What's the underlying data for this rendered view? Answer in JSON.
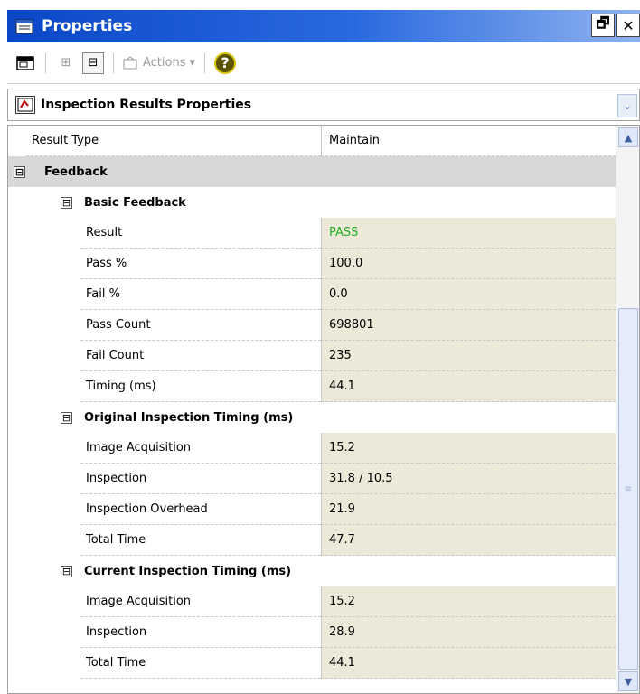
{
  "window": {
    "title": "Properties",
    "restore_glyph": "🗗",
    "close_glyph": "✕"
  },
  "toolbar": {
    "expand_glyph": "⊞",
    "collapse_glyph": "⊟",
    "actions_label": "Actions",
    "actions_arrow": "▾",
    "help_glyph": "?"
  },
  "selector": {
    "label": "Inspection Results Properties",
    "arrow": "⌄"
  },
  "grid": {
    "top_row": {
      "name": "Result Type",
      "value": "Maintain"
    },
    "category": {
      "label": "Feedback",
      "toggle": "⊟"
    },
    "groups": [
      {
        "label": "Basic Feedback",
        "toggle": "⊟",
        "rows": [
          {
            "name": "Result",
            "value": "PASS"
          },
          {
            "name": "Pass %",
            "value": "100.0"
          },
          {
            "name": "Fail %",
            "value": "0.0"
          },
          {
            "name": "Pass Count",
            "value": "698801"
          },
          {
            "name": "Fail Count",
            "value": "235"
          },
          {
            "name": "Timing (ms)",
            "value": "44.1"
          }
        ]
      },
      {
        "label": "Original Inspection Timing (ms)",
        "toggle": "⊟",
        "rows": [
          {
            "name": "Image Acquisition",
            "value": "15.2"
          },
          {
            "name": "Inspection",
            "value": "31.8 / 10.5"
          },
          {
            "name": "Inspection Overhead",
            "value": "21.9"
          },
          {
            "name": "Total Time",
            "value": "47.7"
          }
        ]
      },
      {
        "label": "Current Inspection Timing (ms)",
        "toggle": "⊟",
        "rows": [
          {
            "name": "Image Acquisition",
            "value": "15.2"
          },
          {
            "name": "Inspection",
            "value": "28.9"
          },
          {
            "name": "Total Time",
            "value": "44.1"
          }
        ]
      }
    ]
  },
  "scrollbar": {
    "up": "▲",
    "down": "▼",
    "grip": "≡"
  },
  "colors": {
    "pass_text": "#22b022",
    "title_start": "#0a47c8",
    "title_end": "#8fb2ee",
    "value_bg": "#ece9d8"
  }
}
